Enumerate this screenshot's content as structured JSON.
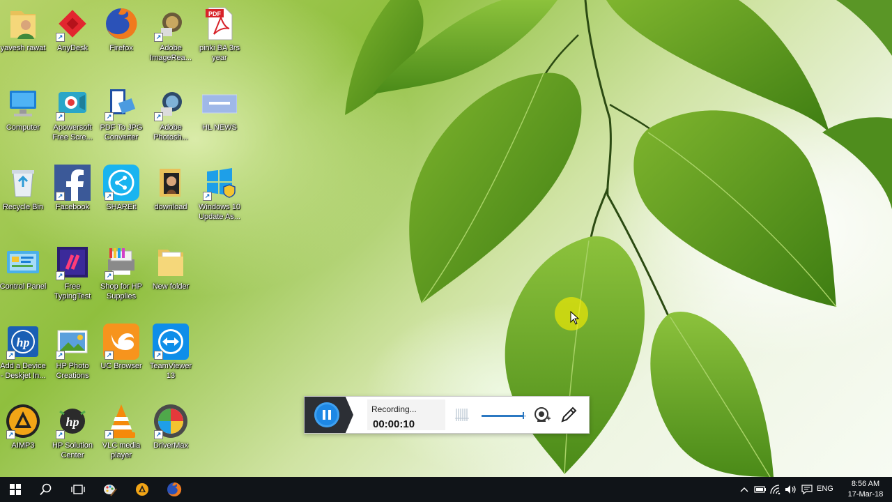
{
  "desktop_icons": [
    {
      "label": "yavesh rawat",
      "icon": "user-folder-icon"
    },
    {
      "label": "AnyDesk",
      "icon": "anydesk-icon"
    },
    {
      "label": "Firefox",
      "icon": "firefox-icon"
    },
    {
      "label": "Adobe ImageRea...",
      "icon": "adobe-imageready-icon"
    },
    {
      "label": "pinki BA 3rs year",
      "icon": "pdf-file-icon"
    },
    {
      "label": "Computer",
      "icon": "computer-icon"
    },
    {
      "label": "Apowersoft Free Scre...",
      "icon": "apowersoft-icon"
    },
    {
      "label": "PDF To JPG Converter",
      "icon": "pdf-to-jpg-icon"
    },
    {
      "label": "Adobe Photosh...",
      "icon": "adobe-photoshop-icon"
    },
    {
      "label": "HL NEWS",
      "icon": "hl-news-icon"
    },
    {
      "label": "Recycle Bin",
      "icon": "recycle-bin-icon"
    },
    {
      "label": "Facebook",
      "icon": "facebook-icon"
    },
    {
      "label": "SHAREit",
      "icon": "shareit-icon"
    },
    {
      "label": "download",
      "icon": "download-folder-icon"
    },
    {
      "label": "Windows 10 Update As...",
      "icon": "windows-update-icon"
    },
    {
      "label": "Control Panel",
      "icon": "control-panel-icon"
    },
    {
      "label": "Free TypingTest",
      "icon": "typing-test-icon"
    },
    {
      "label": "Shop for HP Supplies",
      "icon": "hp-supplies-icon"
    },
    {
      "label": "New folder",
      "icon": "folder-icon"
    },
    {
      "label": "Add a Device - Deskjet In...",
      "icon": "hp-device-icon"
    },
    {
      "label": "HP Photo Creations",
      "icon": "hp-photo-icon"
    },
    {
      "label": "UC Browser",
      "icon": "uc-browser-icon"
    },
    {
      "label": "TeamViewer 13",
      "icon": "teamviewer-icon"
    },
    {
      "label": "AIMP3",
      "icon": "aimp-icon"
    },
    {
      "label": "HP Solution Center",
      "icon": "hp-solution-icon"
    },
    {
      "label": "VLC media player",
      "icon": "vlc-icon"
    },
    {
      "label": "DriverMax",
      "icon": "drivermax-icon"
    }
  ],
  "recorder": {
    "status": "Recording...",
    "elapsed": "00:00:10",
    "volume_level": 0.95
  },
  "taskbar": {
    "pinned": [
      "start-icon",
      "search-icon",
      "task-view-icon",
      "paint-icon",
      "aimp-icon",
      "firefox-icon"
    ],
    "tray_icons": [
      "chevron-up-icon",
      "battery-icon",
      "wifi-icon",
      "speaker-icon",
      "action-center-icon"
    ],
    "language": "ENG",
    "time": "8:56 AM",
    "date": "17-Mar-18"
  },
  "colors": {
    "taskbar_bg": "#101418",
    "recorder_accent": "#1e88e5",
    "cursor_highlight": "#fff000"
  }
}
